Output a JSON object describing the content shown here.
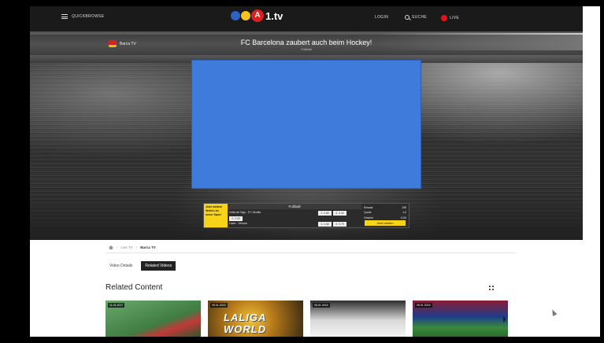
{
  "header": {
    "quickbrowse_label": "QUICKBROWSE",
    "logo_text": "1.tv",
    "login_label": "LOGIN",
    "search_label": "SUCHE",
    "live_label": "LIVE"
  },
  "video": {
    "channel_name": "Barca TV",
    "title": "FC Barcelona zaubert auch beim Hockey!",
    "category": "Fußball"
  },
  "odds_widget": {
    "promo": "Jetzt wetten! Wetten ist unser Sport",
    "sport": "Fußball",
    "match1": "Celta de Vigo - FC Sevilla",
    "match1_odds": [
      "1: 2,80",
      "X: 3,40",
      "2: 2,50"
    ],
    "match2": "Lazio - Verona",
    "match2_odds": [
      "1: 1,60",
      "X: 3,70"
    ],
    "right_lines": [
      "Einsatz",
      "Quote",
      "Gewinn"
    ],
    "right_values": [
      "10€",
      "1,0",
      "0,00"
    ],
    "bet_label": "Jetzt wetten"
  },
  "breadcrumb": {
    "items": [
      "Live TV",
      "Barca TV"
    ]
  },
  "tabs": {
    "details": "Video Details",
    "related": "Related Videos"
  },
  "related": {
    "title": "Related Content",
    "items": [
      {
        "date": "11.01.2017"
      },
      {
        "date": "09.01.2015",
        "word": "LALIGA WORLD"
      },
      {
        "date": "05.01.2015"
      },
      {
        "date": "06.01.2015"
      }
    ]
  },
  "colors": {
    "brand_red": "#d92020",
    "brand_yellow": "#f6c21b",
    "player_placeholder": "#3f7bdb"
  }
}
